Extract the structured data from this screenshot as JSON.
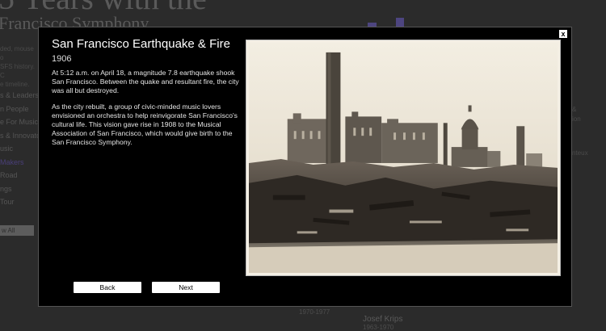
{
  "background": {
    "title_line1": "5 Years with the",
    "title_line2": "Francisco Symphony",
    "intro_lines": [
      "ded, mouse o",
      "SFS history. C",
      "e timeline."
    ],
    "nav_items": [
      {
        "label": "s & Leaders",
        "active": false
      },
      {
        "label": "n People",
        "active": false
      },
      {
        "label": "e For Music",
        "active": false
      },
      {
        "label": "s & Innovato",
        "active": false
      },
      {
        "label": "usic",
        "active": false
      },
      {
        "label": "Makers",
        "active": true
      },
      {
        "label": "Road",
        "active": false
      },
      {
        "label": "ngs",
        "active": false
      },
      {
        "label": "Tour",
        "active": false
      }
    ],
    "view_all_label": "w All",
    "right_fragments": [
      "&",
      "ion",
      "nteux"
    ],
    "bottom_items": [
      {
        "label": "1970-1977",
        "kind": "date"
      },
      {
        "label": "Josef Krips",
        "kind": "name"
      },
      {
        "label": "1963-1970",
        "kind": "date"
      }
    ]
  },
  "modal": {
    "close_label": "x",
    "title": "San Francisco Earthquake & Fire",
    "year": "1906",
    "paragraph1": "At 5:12 a.m. on April 18, a magnitude 7.8 earthquake shook San Francisco. Between the quake and resultant fire, the city was all but destroyed.",
    "paragraph2": "As the city rebuilt, a group of civic-minded music lovers envisioned an orchestra to help reinvigorate San Francisco's cultural life. This vision gave rise in 1908 to the Musical Association of San Francisco, which would give birth to the San Francisco Symphony.",
    "back_label": "Back",
    "next_label": "Next",
    "photo_subject": "sepia photograph of ruins after the 1906 earthquake"
  }
}
